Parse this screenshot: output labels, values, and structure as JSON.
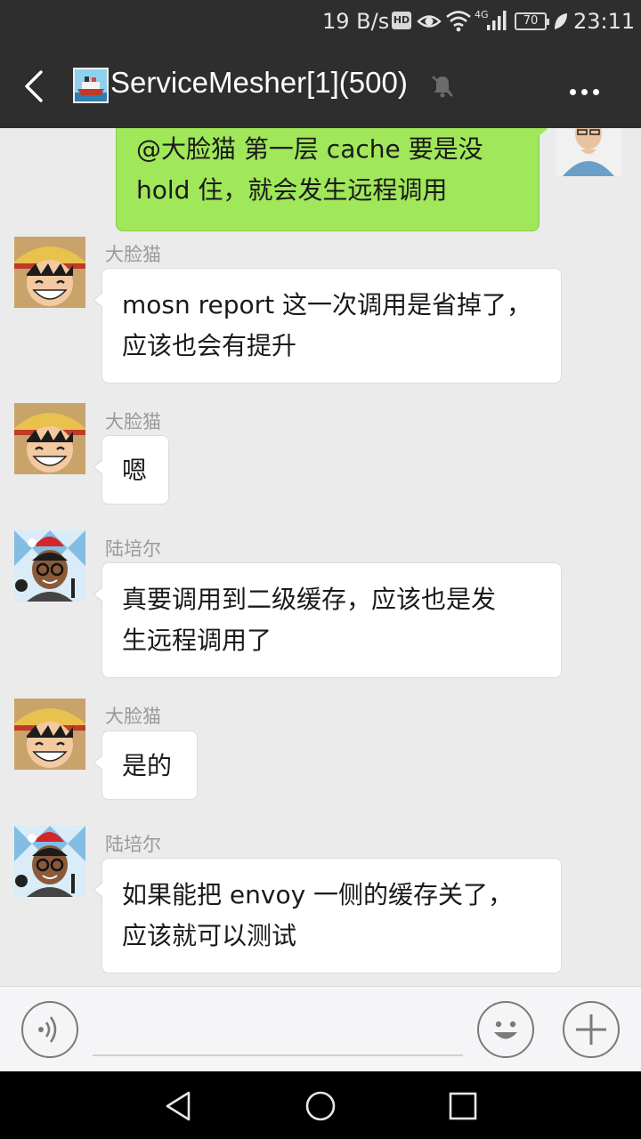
{
  "status_bar": {
    "network_speed": "19 B/s",
    "hd_badge": "HD",
    "network_type": "4G",
    "battery": "70",
    "time": "23:11",
    "icons": [
      "eye-icon",
      "wifi-icon",
      "signal-icon",
      "leaf-icon"
    ]
  },
  "header": {
    "title": "ServiceMesher[1](500)",
    "back_icon": "back-icon",
    "mute_icon": "mute-icon",
    "more_icon": "more-icon"
  },
  "messages": [
    {
      "sender": "",
      "mine": true,
      "text_lines": [
        "@大脸猫  第一层 cache 要是没",
        "hold 住，就会发生远程调用"
      ]
    },
    {
      "sender": "大脸猫",
      "mine": false,
      "text_lines": [
        "mosn report 这一次调用是省掉了，",
        "应该也会有提升"
      ]
    },
    {
      "sender": "大脸猫",
      "mine": false,
      "text_lines": [
        "嗯"
      ]
    },
    {
      "sender": "陆培尔",
      "mine": false,
      "text_lines": [
        "真要调用到二级缓存，应该也是发",
        "生远程调用了"
      ]
    },
    {
      "sender": "大脸猫",
      "mine": false,
      "text_lines": [
        "是的"
      ]
    },
    {
      "sender": "陆培尔",
      "mine": false,
      "text_lines": [
        "如果能把 envoy 一侧的缓存关了，",
        "应该就可以测试"
      ]
    }
  ],
  "input_bar": {
    "placeholder": "",
    "icons": [
      "voice-icon",
      "emoji-icon",
      "plus-icon"
    ]
  },
  "colors": {
    "header_bg": "#2e2e2e",
    "chat_bg": "#ebebeb",
    "my_bubble": "#a0e75a",
    "other_bubble": "#ffffff"
  }
}
